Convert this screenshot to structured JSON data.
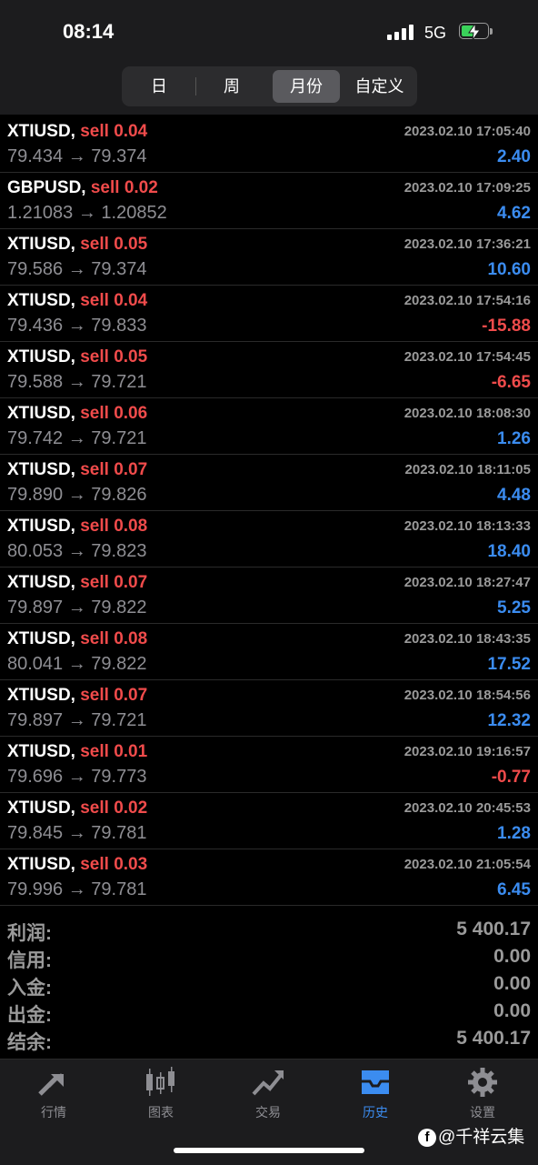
{
  "status_bar": {
    "time": "08:14",
    "network": "5G"
  },
  "period_tabs": [
    {
      "label": "日"
    },
    {
      "label": "周"
    },
    {
      "label": "月份",
      "active": true
    },
    {
      "label": "自定义"
    }
  ],
  "trades": [
    {
      "symbol": "XTIUSD,",
      "side": "sell 0.04",
      "time": "2023.02.10 17:05:40",
      "prices": "79.434 → 79.374",
      "profit": "2.40",
      "positive": true
    },
    {
      "symbol": "GBPUSD,",
      "side": "sell 0.02",
      "time": "2023.02.10 17:09:25",
      "prices": "1.21083 → 1.20852",
      "profit": "4.62",
      "positive": true
    },
    {
      "symbol": "XTIUSD,",
      "side": "sell 0.05",
      "time": "2023.02.10 17:36:21",
      "prices": "79.586 → 79.374",
      "profit": "10.60",
      "positive": true
    },
    {
      "symbol": "XTIUSD,",
      "side": "sell 0.04",
      "time": "2023.02.10 17:54:16",
      "prices": "79.436 → 79.833",
      "profit": "-15.88",
      "positive": false
    },
    {
      "symbol": "XTIUSD,",
      "side": "sell 0.05",
      "time": "2023.02.10 17:54:45",
      "prices": "79.588 → 79.721",
      "profit": "-6.65",
      "positive": false
    },
    {
      "symbol": "XTIUSD,",
      "side": "sell 0.06",
      "time": "2023.02.10 18:08:30",
      "prices": "79.742 → 79.721",
      "profit": "1.26",
      "positive": true
    },
    {
      "symbol": "XTIUSD,",
      "side": "sell 0.07",
      "time": "2023.02.10 18:11:05",
      "prices": "79.890 → 79.826",
      "profit": "4.48",
      "positive": true
    },
    {
      "symbol": "XTIUSD,",
      "side": "sell 0.08",
      "time": "2023.02.10 18:13:33",
      "prices": "80.053 → 79.823",
      "profit": "18.40",
      "positive": true
    },
    {
      "symbol": "XTIUSD,",
      "side": "sell 0.07",
      "time": "2023.02.10 18:27:47",
      "prices": "79.897 → 79.822",
      "profit": "5.25",
      "positive": true
    },
    {
      "symbol": "XTIUSD,",
      "side": "sell 0.08",
      "time": "2023.02.10 18:43:35",
      "prices": "80.041 → 79.822",
      "profit": "17.52",
      "positive": true
    },
    {
      "symbol": "XTIUSD,",
      "side": "sell 0.07",
      "time": "2023.02.10 18:54:56",
      "prices": "79.897 → 79.721",
      "profit": "12.32",
      "positive": true
    },
    {
      "symbol": "XTIUSD,",
      "side": "sell 0.01",
      "time": "2023.02.10 19:16:57",
      "prices": "79.696 → 79.773",
      "profit": "-0.77",
      "positive": false
    },
    {
      "symbol": "XTIUSD,",
      "side": "sell 0.02",
      "time": "2023.02.10 20:45:53",
      "prices": "79.845 → 79.781",
      "profit": "1.28",
      "positive": true
    },
    {
      "symbol": "XTIUSD,",
      "side": "sell 0.03",
      "time": "2023.02.10 21:05:54",
      "prices": "79.996 → 79.781",
      "profit": "6.45",
      "positive": true
    }
  ],
  "summary": [
    {
      "label": "利润:",
      "value": "5 400.17"
    },
    {
      "label": "信用:",
      "value": "0.00"
    },
    {
      "label": "入金:",
      "value": "0.00"
    },
    {
      "label": "出金:",
      "value": "0.00"
    },
    {
      "label": "结余:",
      "value": "5 400.17"
    }
  ],
  "tabbar": [
    {
      "label": "行情",
      "icon": "quotes-arrows-icon"
    },
    {
      "label": "图表",
      "icon": "candlestick-chart-icon"
    },
    {
      "label": "交易",
      "icon": "trade-trend-icon"
    },
    {
      "label": "历史",
      "icon": "history-inbox-icon",
      "active": true
    },
    {
      "label": "设置",
      "icon": "gear-icon"
    }
  ],
  "watermark": {
    "text": "@千祥云集"
  },
  "colors": {
    "positive": "#3b8cf0",
    "negative": "#f04b4b",
    "active_tab": "#3b8cf0"
  }
}
